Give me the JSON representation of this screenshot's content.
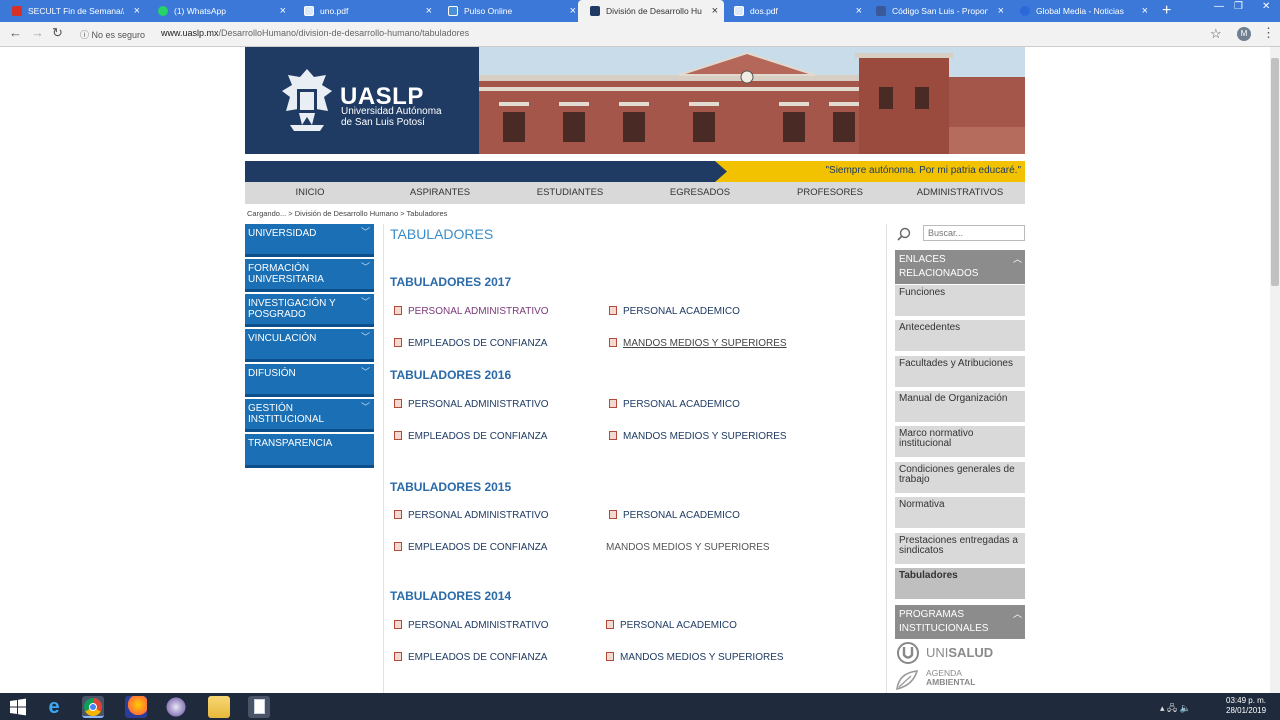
{
  "browser": {
    "tabs": [
      {
        "label": "SECULT Fin de Semana// SE",
        "icon": "gmail-icon",
        "color": "#d93025"
      },
      {
        "label": "(1) WhatsApp",
        "icon": "whatsapp-icon",
        "color": "#25d366"
      },
      {
        "label": "uno.pdf",
        "icon": "document-icon",
        "color": "#5f9cef"
      },
      {
        "label": "Pulso Online",
        "icon": "pulso-icon",
        "color": "#4a90d9"
      },
      {
        "label": "División de Desarrollo Huma",
        "icon": "uaslp-icon",
        "color": "#1f3b63",
        "active": true
      },
      {
        "label": "dos.pdf",
        "icon": "document-icon",
        "color": "#5f9cef"
      },
      {
        "label": "Código San Luis - Propone",
        "icon": "facebook-icon",
        "color": "#3b5998"
      },
      {
        "label": "Global Media - Noticias",
        "icon": "globe-icon",
        "color": "#2b68d9"
      }
    ],
    "tab_close": "×",
    "new_tab": "+",
    "window_controls": {
      "minimize": "—",
      "restore": "❐",
      "close": "✕"
    },
    "security_label": "No es seguro",
    "url_host": "www.uaslp.mx",
    "url_path": "/DesarrolloHumano/division-de-desarrollo-humano/tabuladores",
    "profile_initial": "M"
  },
  "site": {
    "logo_title": "UASLP",
    "logo_subtitle_1": "Universidad Autónoma",
    "logo_subtitle_2": "de San Luis Potosí",
    "motto": "\"Siempre autónoma. Por mi patria educaré.\"",
    "nav": [
      "INICIO",
      "ASPIRANTES",
      "ESTUDIANTES",
      "EGRESADOS",
      "PROFESORES",
      "ADMINISTRATIVOS"
    ],
    "breadcrumb": "Cargando... > División de Desarrollo Humano > Tabuladores"
  },
  "sidebar": {
    "items": [
      {
        "label": "UNIVERSIDAD",
        "chevron": "﹀"
      },
      {
        "label": "FORMACIÓN UNIVERSITARIA",
        "chevron": "﹀"
      },
      {
        "label": "INVESTIGACIÓN Y POSGRADO",
        "chevron": "﹀"
      },
      {
        "label": "VINCULACIÓN",
        "chevron": "﹀"
      },
      {
        "label": "DIFUSIÓN",
        "chevron": "﹀"
      },
      {
        "label": "GESTIÓN INSTITUCIONAL",
        "chevron": "﹀"
      },
      {
        "label": "TRANSPARENCIA",
        "chevron": ""
      }
    ]
  },
  "main": {
    "title": "TABULADORES",
    "sections": [
      {
        "year": "TABULADORES 2017",
        "links": [
          "PERSONAL ADMINISTRATIVO",
          "PERSONAL ACADEMICO",
          "EMPLEADOS DE CONFIANZA",
          "MANDOS MEDIOS Y SUPERIORES"
        ]
      },
      {
        "year": "TABULADORES 2016",
        "links": [
          "PERSONAL ADMINISTRATIVO",
          "PERSONAL ACADEMICO",
          "EMPLEADOS DE CONFIANZA",
          "MANDOS MEDIOS Y SUPERIORES"
        ]
      },
      {
        "year": "TABULADORES 2015",
        "links": [
          "PERSONAL ADMINISTRATIVO",
          "PERSONAL ACADEMICO",
          "EMPLEADOS DE CONFIANZA",
          "MANDOS MEDIOS Y SUPERIORES"
        ]
      },
      {
        "year": "TABULADORES 2014",
        "links": [
          "PERSONAL ADMINISTRATIVO",
          "PERSONAL ACADEMICO",
          "EMPLEADOS DE CONFIANZA",
          "MANDOS MEDIOS Y SUPERIORES"
        ]
      }
    ]
  },
  "right": {
    "search_placeholder": "Buscar...",
    "related_header": "ENLACES RELACIONADOS",
    "related_items": [
      "Funciones",
      "Antecedentes",
      "Facultades y Atribuciones",
      "Manual de Organización",
      "Marco normativo institucional",
      "Condiciones generales de trabajo",
      "Normativa",
      "Prestaciones entregadas a sindicatos",
      "Tabuladores"
    ],
    "programs_header": "PROGRAMAS INSTITUCIONALES",
    "chevron_up": "︿",
    "unisalud_a": "UNI",
    "unisalud_b": "SALUD",
    "agenda_1": "AGENDA",
    "agenda_2": "AMBIENTAL"
  },
  "taskbar": {
    "apps": [
      "windows-start-icon",
      "internet-explorer-icon",
      "chrome-icon",
      "firefox-icon",
      "app-icon",
      "file-explorer-icon",
      "notepad-icon"
    ],
    "time": "03:49 p. m.",
    "date": "28/01/2019"
  }
}
